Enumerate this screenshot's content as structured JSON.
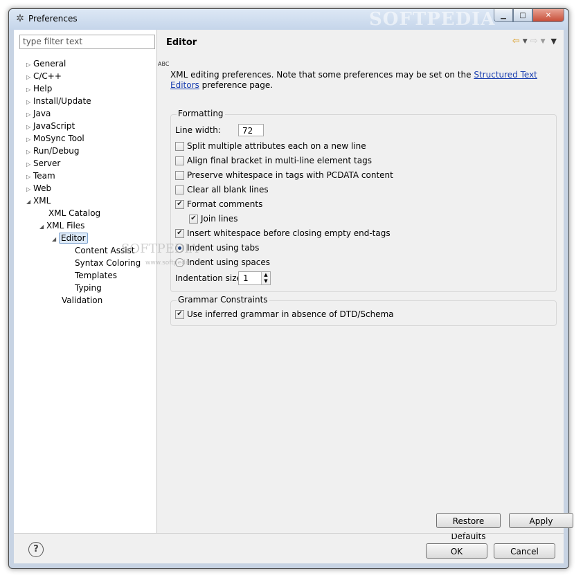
{
  "window": {
    "title": "Preferences",
    "watermark": "SOFTPEDIA"
  },
  "left": {
    "filter_placeholder": "type filter text",
    "tree": [
      {
        "label": "General"
      },
      {
        "label": "C/C++"
      },
      {
        "label": "Help"
      },
      {
        "label": "Install/Update"
      },
      {
        "label": "Java"
      },
      {
        "label": "JavaScript"
      },
      {
        "label": "MoSync Tool"
      },
      {
        "label": "Run/Debug"
      },
      {
        "label": "Server"
      },
      {
        "label": "Team"
      },
      {
        "label": "Web"
      },
      {
        "label": "XML"
      },
      {
        "label": "XML Catalog"
      },
      {
        "label": "XML Files"
      },
      {
        "label": "Editor"
      },
      {
        "label": "Content Assist"
      },
      {
        "label": "Syntax Coloring"
      },
      {
        "label": "Templates"
      },
      {
        "label": "Typing"
      },
      {
        "label": "Validation"
      }
    ]
  },
  "page": {
    "title": "Editor",
    "abc": "ABC",
    "desc_before": "XML editing preferences.  Note that some preferences may be set on the ",
    "desc_link": "Structured Text Editors",
    "desc_after": " preference page.",
    "formatting": {
      "label": "Formatting",
      "line_width_label": "Line width:",
      "line_width_value": "72",
      "split_attrs": "Split multiple attributes each on a new line",
      "align_bracket": "Align final bracket in multi-line element tags",
      "preserve_ws": "Preserve whitespace in tags with PCDATA content",
      "clear_blank": "Clear all blank lines",
      "format_comments": "Format comments",
      "join_lines": "Join lines",
      "insert_ws": "Insert whitespace before closing empty end-tags",
      "indent_tabs": "Indent using tabs",
      "indent_spaces": "Indent using spaces",
      "indent_size_label": "Indentation size:",
      "indent_size_value": "1"
    },
    "grammar": {
      "label": "Grammar Constraints",
      "use_inferred": "Use inferred grammar in absence of DTD/Schema"
    },
    "restore_defaults": "Restore Defaults",
    "apply": "Apply"
  },
  "footer": {
    "help": "?",
    "ok": "OK",
    "cancel": "Cancel"
  },
  "watermark_body": "SOFTPEDIA",
  "watermark_url": "www.softpedia.com"
}
